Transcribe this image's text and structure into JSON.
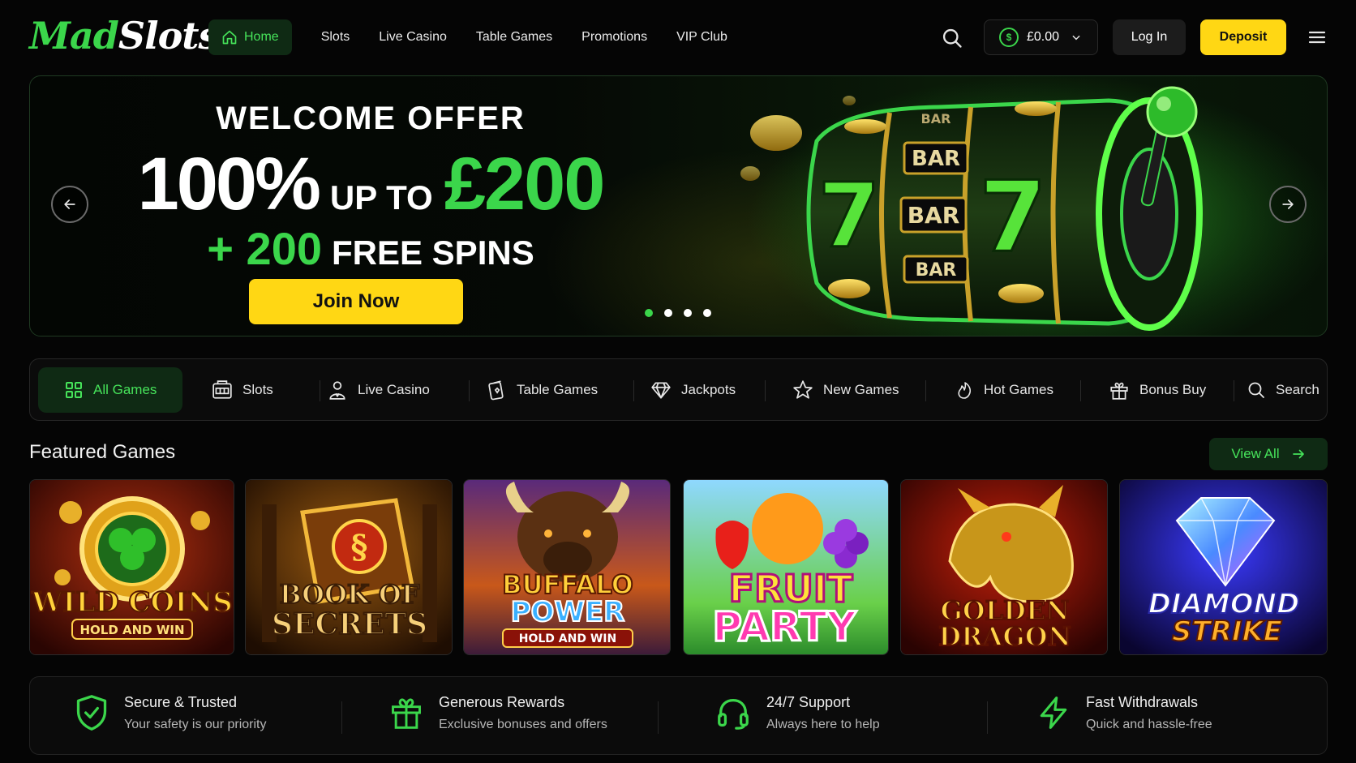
{
  "brand": {
    "logo_part1": "Mad",
    "logo_part2": "Slots"
  },
  "nav": {
    "items": [
      {
        "label": "Home",
        "active": true
      },
      {
        "label": "Slots"
      },
      {
        "label": "Live Casino"
      },
      {
        "label": "Table Games"
      },
      {
        "label": "Promotions"
      },
      {
        "label": "VIP Club"
      }
    ]
  },
  "header": {
    "balance": "£0.00",
    "login_label": "Log In",
    "deposit_label": "Deposit",
    "icons": [
      "search-icon",
      "coin-icon",
      "chevron-down-icon",
      "hamburger-menu-icon"
    ]
  },
  "hero": {
    "welcome": "WELCOME OFFER",
    "percent": "100%",
    "up_to": "UP TO",
    "amount": "£200",
    "spins_prefix": "+ 200",
    "spins_text": "FREE SPINS",
    "cta": "Join Now",
    "slide_count": 4,
    "active_slide": 1,
    "reel_labels": [
      "7",
      "BAR",
      "BAR",
      "BAR",
      "BAR",
      "7"
    ]
  },
  "categories": [
    {
      "label": "All Games",
      "icon": "grid-icon",
      "active": true
    },
    {
      "label": "Slots",
      "icon": "slot-machine-icon"
    },
    {
      "label": "Live Casino",
      "icon": "dealer-icon"
    },
    {
      "label": "Table Games",
      "icon": "cards-icon"
    },
    {
      "label": "Jackpots",
      "icon": "diamond-icon"
    },
    {
      "label": "New Games",
      "icon": "star-icon"
    },
    {
      "label": "Hot Games",
      "icon": "flame-icon"
    },
    {
      "label": "Bonus Buy",
      "icon": "gift-icon"
    },
    {
      "label": "Search",
      "icon": "search-icon"
    }
  ],
  "featured": {
    "title": "Featured Games",
    "view_all": "View All",
    "games": [
      {
        "title_line1": "WILD COINS",
        "title_line2": "HOLD AND WIN"
      },
      {
        "title_line1": "BOOK OF",
        "title_line2": "SECRETS"
      },
      {
        "title_line1": "BUFFALO",
        "title_line2": "POWER",
        "title_line3": "HOLD AND WIN"
      },
      {
        "title_line1": "FRUIT",
        "title_line2": "PARTY"
      },
      {
        "title_line1": "GOLDEN",
        "title_line2": "DRAGON"
      },
      {
        "title_line1": "DIAMOND",
        "title_line2": "STRIKE"
      }
    ]
  },
  "features": [
    {
      "title": "Secure & Trusted",
      "subtitle": "Your safety is our priority",
      "icon": "shield-check-icon"
    },
    {
      "title": "Generous Rewards",
      "subtitle": "Exclusive bonuses and offers",
      "icon": "gift-icon"
    },
    {
      "title": "24/7 Support",
      "subtitle": "Always here to help",
      "icon": "headset-icon"
    },
    {
      "title": "Fast Withdrawals",
      "subtitle": "Quick and hassle-free",
      "icon": "lightning-icon"
    }
  ],
  "colors": {
    "accent_green": "#3bd64b",
    "cta_yellow": "#ffd714",
    "background": "#050505"
  }
}
